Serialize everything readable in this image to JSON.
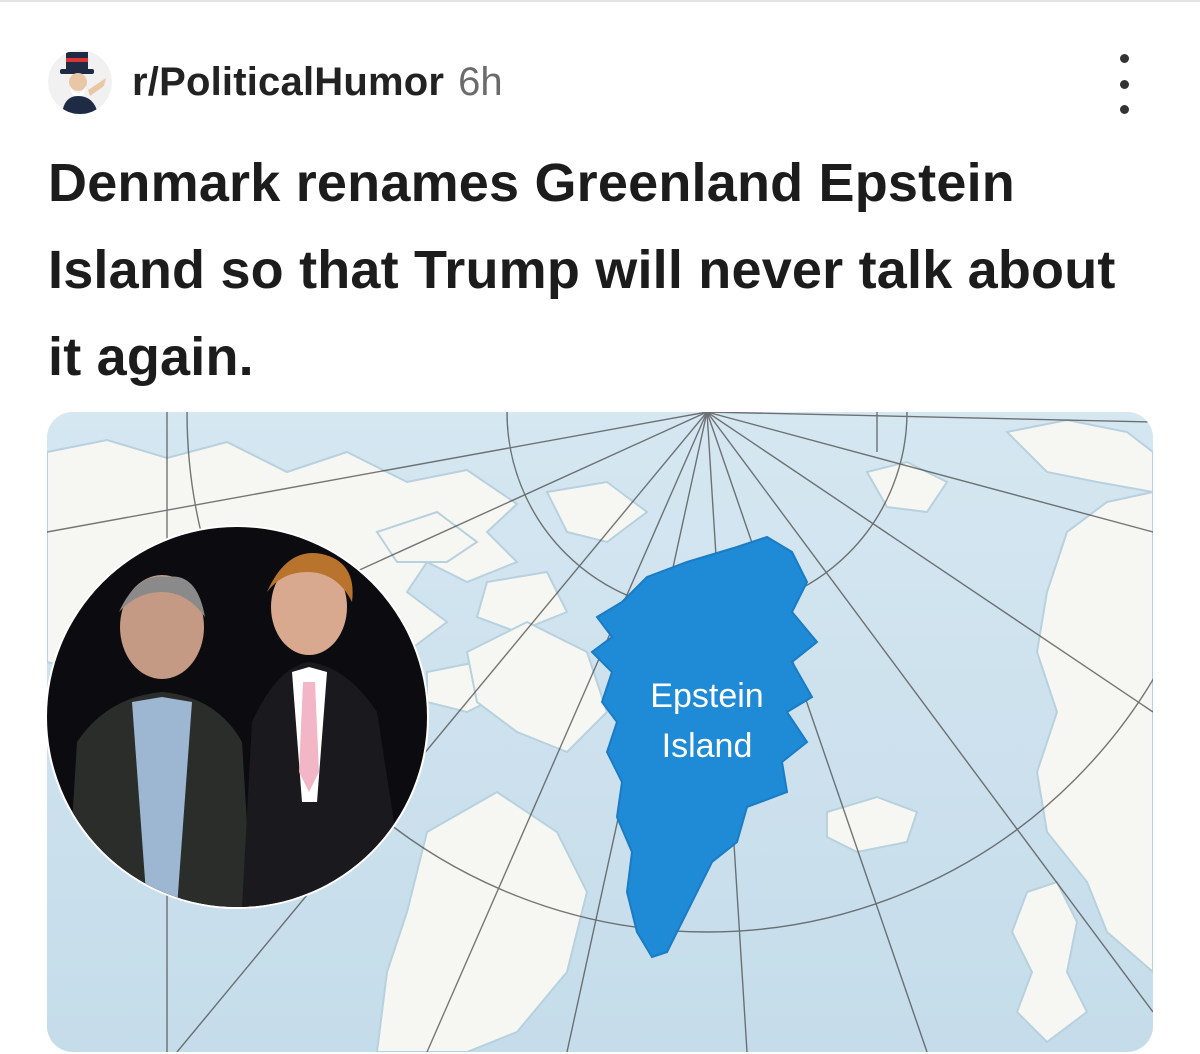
{
  "post": {
    "subreddit": "r/PoliticalHumor",
    "age": "6h",
    "title": "Denmark renames Greenland Epstein Island so that Trump will never talk about it again.",
    "more_icon": "more-vertical-icon",
    "avatar_icon": "uncle-sam-avatar"
  },
  "map": {
    "label_line1": "Epstein",
    "label_line2": "Island",
    "island_color": "#1f8ad6",
    "ocean_color": "#cfe3ee",
    "land_color": "#f6f6f2"
  },
  "photo": {
    "description_icon": "two-men-photo"
  }
}
